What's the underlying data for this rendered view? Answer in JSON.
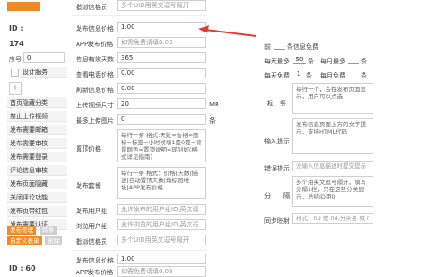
{
  "colors": {
    "accent_orange": "#f08a24",
    "arrow_red": "#e53935",
    "border": "#cfcfcf"
  },
  "sidebar": {
    "top_button": "",
    "id_label": "ID :",
    "id_value": "174",
    "seq_label": "序号",
    "seq_value": "0",
    "settings_item": "设计服务",
    "plus": "+",
    "items": [
      "首页隐藏分类",
      "禁止上传视频",
      "发布需要邮箱",
      "发布需要审核",
      "发布需要登录",
      "评论信息审核",
      "发布页面隐藏",
      "关闭评论功能",
      "发布页带红包",
      "发布需要认证"
    ],
    "btn_manage": "发布管理",
    "btn_move": "转移",
    "btn_customize": "自定义表单",
    "btn_delete": "删除",
    "bottom_id": "ID : 60"
  },
  "form": {
    "top_label": "指派信格员",
    "top_value": "多个UID用英文逗号隔开",
    "rows": [
      {
        "label": "发布信息价格",
        "value": "1.00",
        "placeholder": false
      },
      {
        "label": "APP发布价格",
        "value": "如需免费请填0.03",
        "placeholder": true
      },
      {
        "label": "信息有效天数",
        "value": "365",
        "placeholder": false
      },
      {
        "label": "查看电话价格",
        "value": "0.00",
        "placeholder": false
      },
      {
        "label": "刷新信息价格",
        "value": "0.00",
        "placeholder": false
      },
      {
        "label": "上传视频尺寸",
        "value": "20",
        "placeholder": false,
        "unit": "MB"
      },
      {
        "label": "最多上传图片",
        "value": "0",
        "placeholder": false,
        "unit": "条"
      }
    ],
    "price_label": "置顶价格",
    "price_text": "每行一条 格式:天数=价格=图标=标签=小时候填1是0是=背景颜色=置顶说明=现别如(格式详见指南)",
    "app_label": "发布套餐",
    "app_text": "每行一条 格式：价格[天数]描述|自动置顶天数|角标图地址|APP发布价格",
    "user_label": "发布用户组",
    "user_value": "允许发布的用户组ID,英文逗",
    "browse_label": "浏览用户组",
    "browse_value": "允许浏览的用户组ID,英文逗",
    "assign_label": "指派信格员",
    "assign_value": "多个UID用英文逗号隔开",
    "bottom_label": "发布信息价格",
    "bottom_value": "1.00",
    "bottom2_label": "APP发布价格",
    "bottom2_value": "如需免费请填0.03"
  },
  "right": {
    "line1_prefix": "前",
    "line1_suffix": "条信息免费",
    "line2_a": "每天最多",
    "line2_a_val": "50",
    "line2_a_unit": "条",
    "line2_b": "每月最多",
    "line2_b_unit": "条",
    "line3_a": "每天免费",
    "line3_a_val": "1",
    "line3_a_unit": "条",
    "line3_b": "每月免费",
    "line3_b_unit": "条",
    "tags_label": "标　签",
    "tags_text": "每行一个，会在发布页面显示，用户可以点选",
    "input_tip_label": "输入提示",
    "input_tip_text": "发布信息页面上方的文字提示，支持HTML代码",
    "error_tip_label": "错误提示",
    "error_tip_text": "没输入信息描述时提交提示",
    "split_label": "分　　隔",
    "split_text": "多个用英文逗号隔开，填写分隔1栏，只在这些分类显示，总结ID用0",
    "sync_label": "同步映射",
    "sync_text": "格式：fid 或 fid,分类名 或 f"
  }
}
